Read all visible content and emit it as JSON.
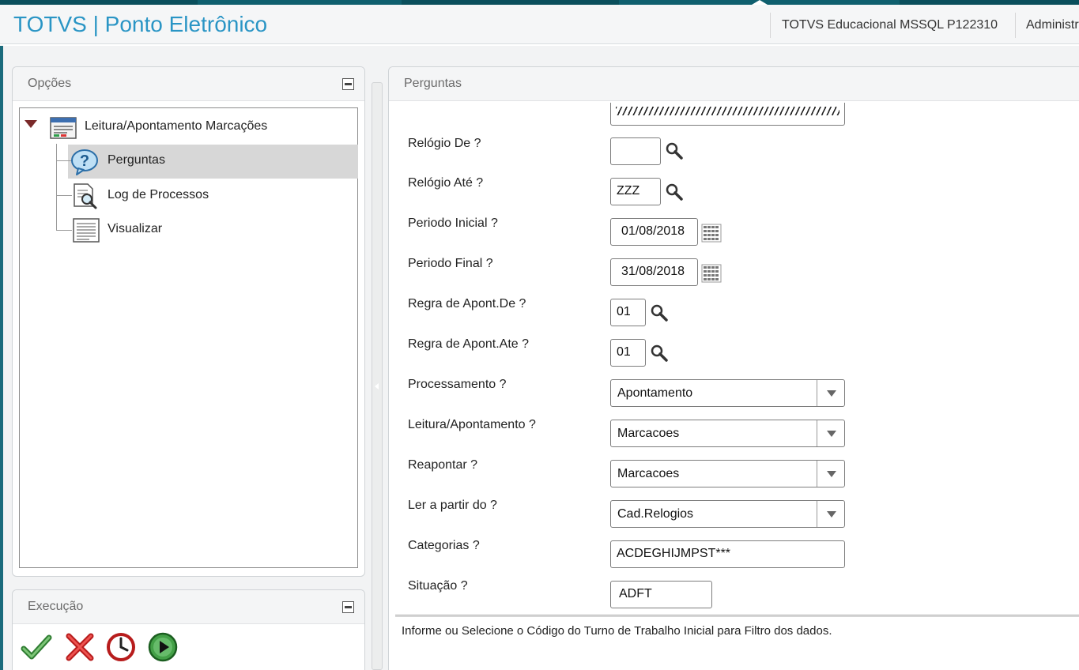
{
  "header": {
    "app_title": "TOTVS | Ponto Eletrônico",
    "environment": "TOTVS Educacional MSSQL P122310",
    "user": "Administr"
  },
  "opcoes": {
    "title": "Opções",
    "tree": {
      "root": {
        "label": "Leitura/Apontamento Marcações",
        "icon": "window-list-icon",
        "expanded": true
      },
      "children": [
        {
          "label": "Perguntas",
          "icon": "question-bubble-icon",
          "selected": true
        },
        {
          "label": "Log de Processos",
          "icon": "document-search-icon",
          "selected": false
        },
        {
          "label": "Visualizar",
          "icon": "report-view-icon",
          "selected": false
        }
      ]
    }
  },
  "execucao": {
    "title": "Execução",
    "actions": [
      {
        "name": "confirm",
        "icon": "check-icon"
      },
      {
        "name": "cancel",
        "icon": "x-icon"
      },
      {
        "name": "schedule",
        "icon": "clock-icon"
      },
      {
        "name": "run",
        "icon": "play-icon"
      }
    ]
  },
  "perguntas": {
    "title": "Perguntas",
    "questions": [
      {
        "label": "Relógio De ?",
        "type": "lookup",
        "value": ""
      },
      {
        "label": "Relógio Até ?",
        "type": "lookup",
        "value": "ZZZ"
      },
      {
        "label": "Periodo Inicial ?",
        "type": "date",
        "value": "01/08/2018"
      },
      {
        "label": "Periodo Final ?",
        "type": "date",
        "value": "31/08/2018"
      },
      {
        "label": "Regra de Apont.De ?",
        "type": "lookup",
        "value": "01"
      },
      {
        "label": "Regra de Apont.Ate ?",
        "type": "lookup",
        "value": "01"
      },
      {
        "label": "Processamento ?",
        "type": "select",
        "value": "Apontamento"
      },
      {
        "label": "Leitura/Apontamento ?",
        "type": "select",
        "value": "Marcacoes"
      },
      {
        "label": "Reapontar ?",
        "type": "select",
        "value": "Marcacoes"
      },
      {
        "label": "Ler a partir do ?",
        "type": "select",
        "value": "Cad.Relogios"
      },
      {
        "label": "Categorias ?",
        "type": "text",
        "value": "ACDEGHIJMPST***"
      },
      {
        "label": "Situação ?",
        "type": "text",
        "value": "ADFT"
      }
    ],
    "help_text": "Informe ou Selecione o Código do Turno de Trabalho Inicial para Filtro dos dados."
  },
  "colors": {
    "brand": "#2a95c5",
    "top_bar": "#0f5f6e",
    "selection": "#d7d7d7"
  }
}
